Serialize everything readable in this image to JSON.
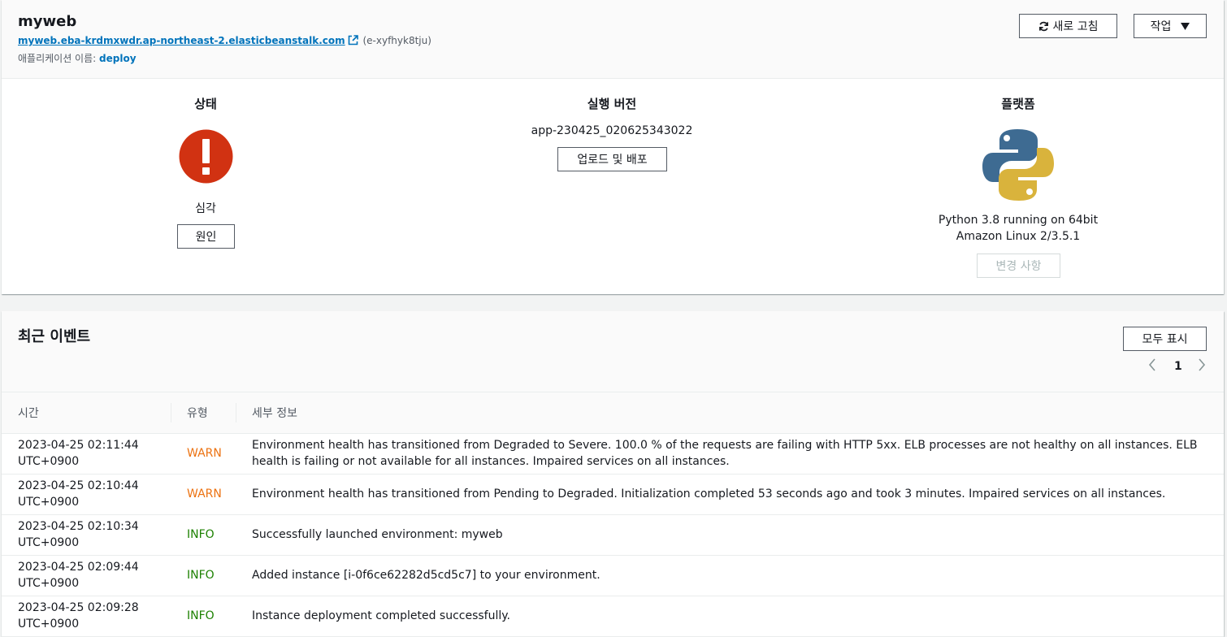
{
  "environment": {
    "name": "myweb",
    "url": "myweb.eba-krdmxwdr.ap-northeast-2.elasticbeanstalk.com",
    "env_id": "(e-xyfhyk8tju)",
    "app_label": "애플리케이션 이름:",
    "app_name": "deploy",
    "refresh_label": "새로 고침",
    "actions_label": "작업"
  },
  "health": {
    "title": "상태",
    "status": "심각",
    "causes_label": "원인",
    "status_color": "#d13212"
  },
  "version": {
    "title": "실행 버전",
    "label": "app-230425_020625343022",
    "upload_label": "업로드 및 배포"
  },
  "platform": {
    "title": "플랫폼",
    "line1": "Python 3.8 running on 64bit",
    "line2": "Amazon Linux 2/3.5.1",
    "change_label": "변경 사항",
    "icon": "python-logo-icon"
  },
  "events": {
    "title": "최근 이벤트",
    "show_all_label": "모두 표시",
    "page": "1",
    "columns": [
      "시간",
      "유형",
      "세부 정보"
    ],
    "rows": [
      {
        "date": "2023-04-25 02:11:44",
        "tz": "UTC+0900",
        "type": "WARN",
        "detail": "Environment health has transitioned from Degraded to Severe. 100.0 % of the requests are failing with HTTP 5xx. ELB processes are not healthy on all instances. ELB health is failing or not available for all instances. Impaired services on all instances."
      },
      {
        "date": "2023-04-25 02:10:44",
        "tz": "UTC+0900",
        "type": "WARN",
        "detail": "Environment health has transitioned from Pending to Degraded. Initialization completed 53 seconds ago and took 3 minutes. Impaired services on all instances."
      },
      {
        "date": "2023-04-25 02:10:34",
        "tz": "UTC+0900",
        "type": "INFO",
        "detail": "Successfully launched environment: myweb"
      },
      {
        "date": "2023-04-25 02:09:44",
        "tz": "UTC+0900",
        "type": "INFO",
        "detail": "Added instance [i-0f6ce62282d5cd5c7] to your environment."
      },
      {
        "date": "2023-04-25 02:09:28",
        "tz": "UTC+0900",
        "type": "INFO",
        "detail": "Instance deployment completed successfully."
      }
    ]
  }
}
